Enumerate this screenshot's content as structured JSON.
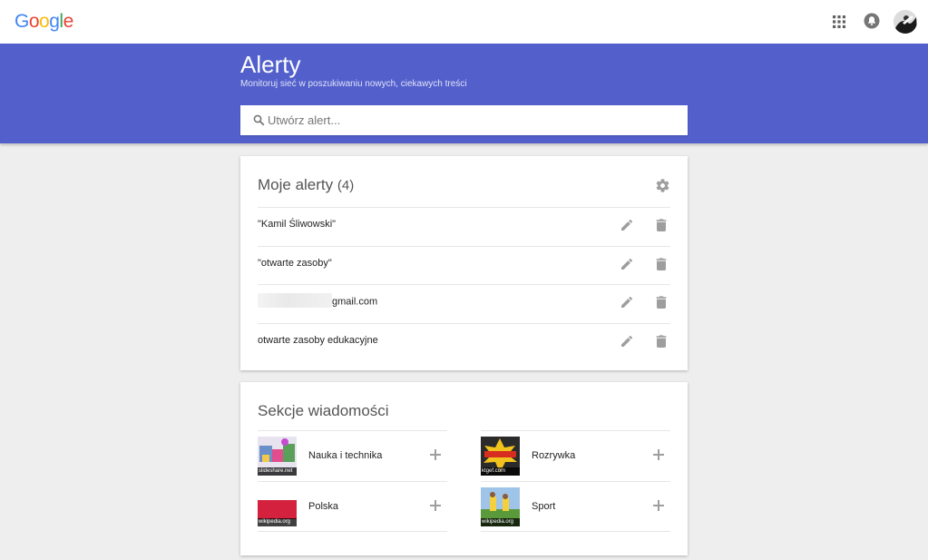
{
  "header": {
    "logo_letters": [
      {
        "ch": "G",
        "color": "#4285F4"
      },
      {
        "ch": "o",
        "color": "#EA4335"
      },
      {
        "ch": "o",
        "color": "#FBBC05"
      },
      {
        "ch": "g",
        "color": "#4285F4"
      },
      {
        "ch": "l",
        "color": "#34A853"
      },
      {
        "ch": "e",
        "color": "#EA4335"
      }
    ],
    "icons": [
      "apps-icon",
      "notifications-icon",
      "avatar"
    ]
  },
  "banner": {
    "title": "Alerty",
    "subtitle": "Monitoruj sieć w poszukiwaniu nowych, ciekawych treści",
    "search_placeholder": "Utwórz alert...",
    "color": "#5360cc"
  },
  "alerts": {
    "title": "Moje alerty",
    "count": "(4)",
    "items": [
      {
        "text": "\"Kamil Śliwowski\"",
        "blurred": false
      },
      {
        "text": "\"otwarte zasoby\"",
        "blurred": false
      },
      {
        "text": "gmail.com",
        "blurred": true
      },
      {
        "text": "otwarte zasoby edukacyjne",
        "blurred": false
      }
    ]
  },
  "news": {
    "title": "Sekcje wiadomości",
    "left": [
      {
        "label": "Nauka i technika",
        "thumb_caption": "slideshare.net"
      },
      {
        "label": "Polska",
        "thumb_caption": "wikipedia.org"
      }
    ],
    "right": [
      {
        "label": "Rozrywka",
        "thumb_caption": "ktgef.com"
      },
      {
        "label": "Sport",
        "thumb_caption": "wikipedia.org"
      }
    ]
  }
}
